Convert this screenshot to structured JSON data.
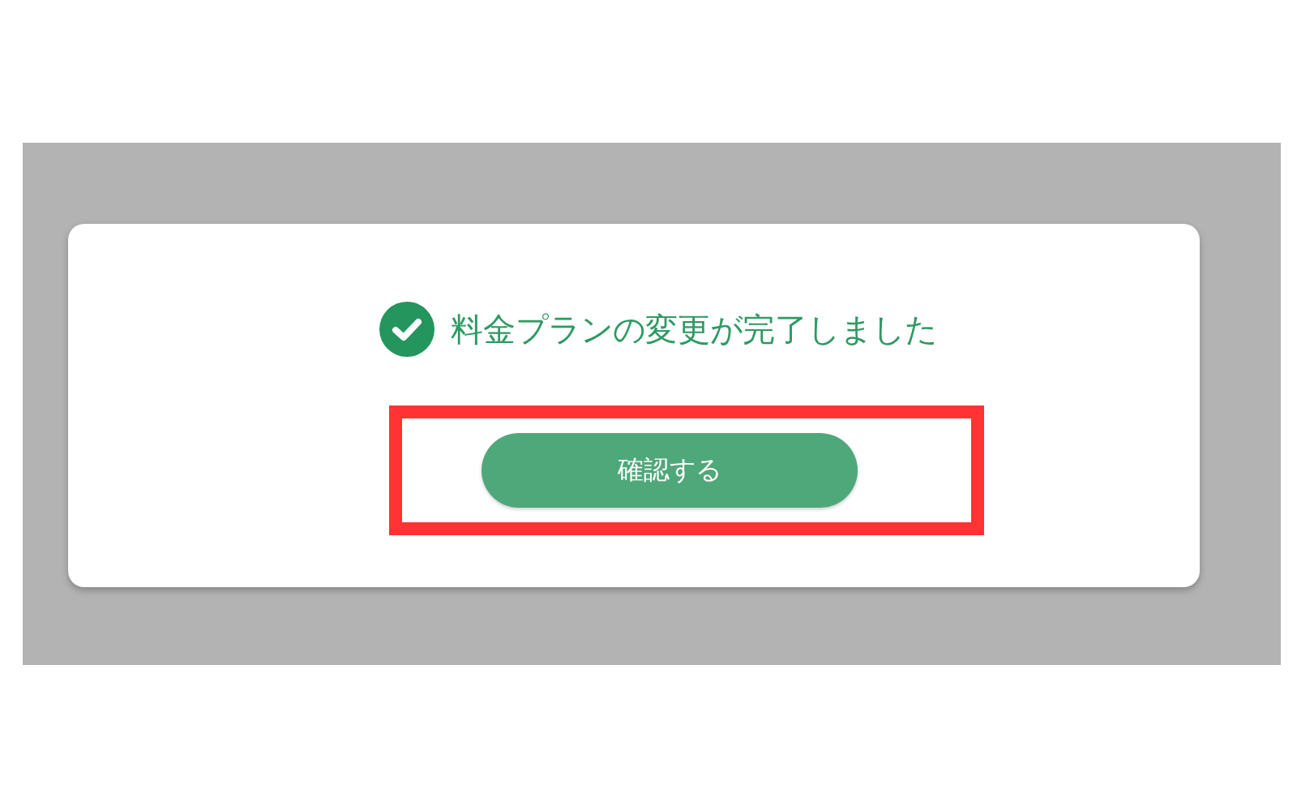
{
  "dialog": {
    "message": "料金プランの変更が完了しました",
    "confirm_button": {
      "label": "確認する",
      "highlighted": true
    }
  }
}
